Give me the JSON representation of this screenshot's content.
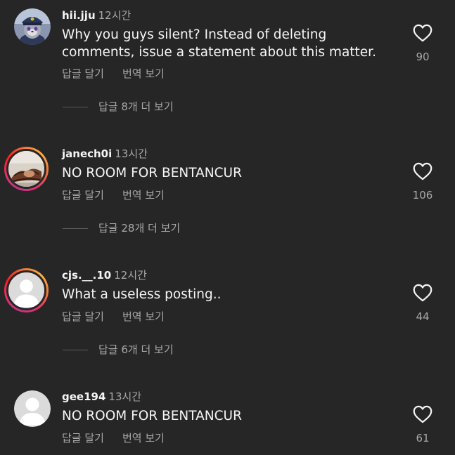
{
  "comments": [
    {
      "username": "hii.jju",
      "time": "12시간",
      "text": "Why you guys silent? Instead of deleting comments, issue a statement about this matter.",
      "reply_label": "답글 달기",
      "translate_label": "번역 보기",
      "view_replies": "답글 8개 더 보기",
      "likes": "90",
      "avatar": "cartoon-character-avatar"
    },
    {
      "username": "janech0i",
      "time": "13시간",
      "text": "NO ROOM FOR BENTANCUR",
      "reply_label": "답글 달기",
      "translate_label": "번역 보기",
      "view_replies": "답글 28개 더 보기",
      "likes": "106",
      "avatar": "photo-avatar-with-story-ring"
    },
    {
      "username": "cjs.__.10",
      "time": "12시간",
      "text": "What a useless posting..",
      "reply_label": "답글 달기",
      "translate_label": "번역 보기",
      "view_replies": "답글 6개 더 보기",
      "likes": "44",
      "avatar": "default-avatar-with-story-ring"
    },
    {
      "username": "gee194",
      "time": "13시간",
      "text": "NO ROOM FOR BENTANCUR",
      "reply_label": "답글 달기",
      "translate_label": "번역 보기",
      "likes": "61",
      "avatar": "default-avatar"
    }
  ],
  "colors": {
    "background": "#262626",
    "primary_text": "#f5f5f5",
    "secondary_text": "#a8a8a8",
    "story_ring": [
      "#c13584",
      "#e1306c",
      "#fd1d1d",
      "#f77737",
      "#fcaf45"
    ]
  },
  "icons": {
    "like": "heart-outline-icon"
  }
}
